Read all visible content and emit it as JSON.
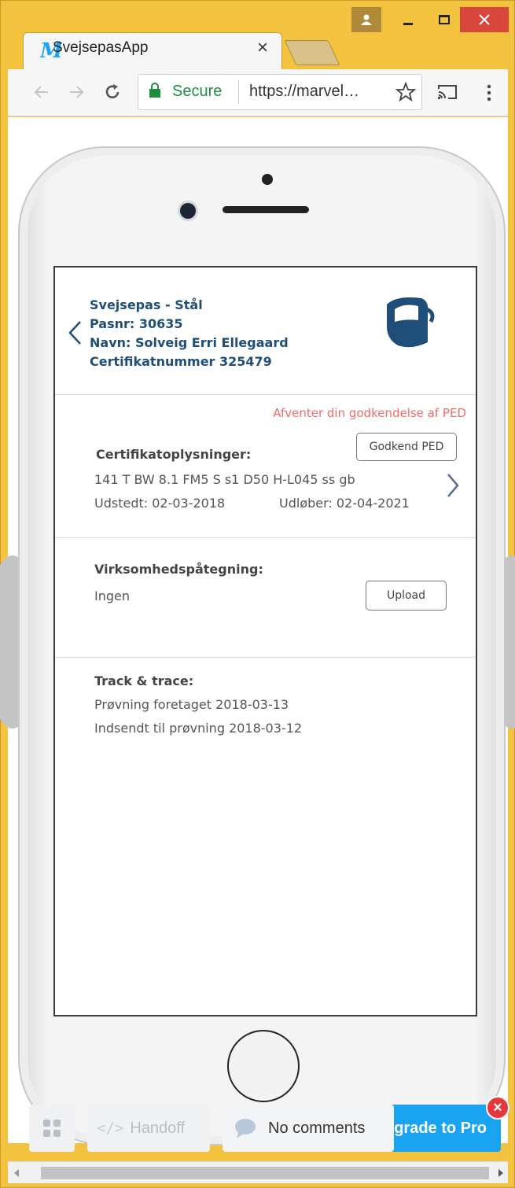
{
  "browser": {
    "tab_title": "SvejsepasApp",
    "tab_close": "×",
    "secure_label": "Secure",
    "url": "https://marvel…",
    "colors": {
      "frame": "#f3c23f",
      "secure_green": "#1e8e3e",
      "close_red": "#d9463b"
    }
  },
  "card": {
    "title": "Svejsepas - Stål",
    "pasnr": "Pasnr: 30635",
    "name": "Navn: Solveig Erri Ellegaard",
    "certnr": "Certifikatnummer 325479",
    "icon": "welding-helmet-icon"
  },
  "certificate": {
    "status": "Afventer din godkendelse af PED",
    "approve_label": "Godkend PED",
    "label": "Certifikatoplysninger:",
    "code": "141 T BW 8.1 FM5 S s1 D50 H-L045 ss gb",
    "issued": "Udstedt: 02-03-2018",
    "expires": "Udløber: 02-04-2021"
  },
  "company": {
    "label": "Virksomhedspåtegning:",
    "value": "Ingen",
    "upload_label": "Upload"
  },
  "tracking": {
    "label": "Track & trace:",
    "events": [
      "Prøvning foretaget 2018-03-13",
      "Indsendt til prøvning 2018-03-12"
    ]
  },
  "marvel_bar": {
    "handoff_label": "Handoff",
    "comments_label": "No comments",
    "upgrade_label": "grade to Pro",
    "close_badge": "×",
    "accent": "#1aa3f0"
  }
}
